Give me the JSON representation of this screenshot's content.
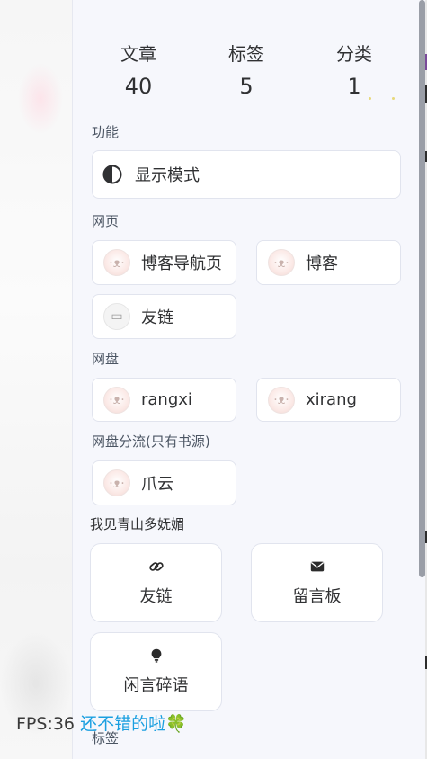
{
  "stats": [
    {
      "label": "文章",
      "value": "40"
    },
    {
      "label": "标签",
      "value": "5"
    },
    {
      "label": "分类",
      "value": "1"
    }
  ],
  "sections": {
    "function": "功能",
    "web": "网页",
    "netdisk": "网盘",
    "netdisk_split": "网盘分流(只有书源)",
    "mountain": "我见青山多妩媚",
    "tags": "标签"
  },
  "function_items": [
    {
      "label": "显示模式",
      "icon": "contrast-icon"
    }
  ],
  "web_items": [
    {
      "label": "博客导航页",
      "icon": "cat-avatar"
    },
    {
      "label": "博客",
      "icon": "cat-avatar"
    },
    {
      "label": "友链",
      "icon": "friends-avatar"
    }
  ],
  "netdisk_items": [
    {
      "label": "rangxi",
      "icon": "cat-avatar"
    },
    {
      "label": "xirang",
      "icon": "cat-avatar"
    }
  ],
  "netdisk_split_items": [
    {
      "label": "爪云",
      "icon": "cat-avatar"
    }
  ],
  "mountain_items": [
    {
      "label": "友链",
      "icon": "link-icon"
    },
    {
      "label": "留言板",
      "icon": "envelope-icon"
    },
    {
      "label": "闲言碎语",
      "icon": "lightbulb-icon"
    }
  ],
  "fps": {
    "label": "FPS:36",
    "message": "还不错的啦🍀"
  },
  "colors": {
    "panel_bg": "#f6f7fc",
    "card_bg": "#ffffff",
    "card_border": "#e1e4ee",
    "fps_message": "#1a9fe0"
  }
}
